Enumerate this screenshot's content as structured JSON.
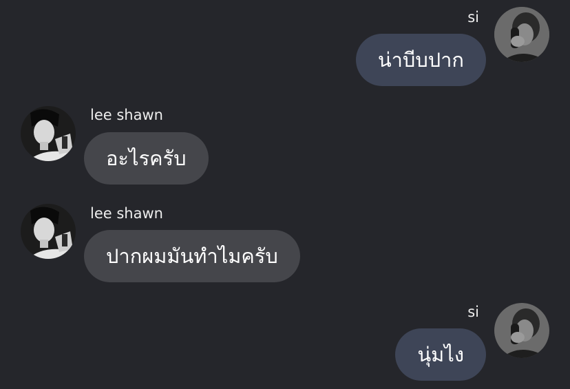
{
  "messages": [
    {
      "sender": "si",
      "text": "น่าบีบปาก",
      "direction": "outgoing"
    },
    {
      "sender": "lee shawn",
      "text": "อะไรครับ",
      "direction": "incoming"
    },
    {
      "sender": "lee shawn",
      "text": "ปากผมมันทำไมครับ",
      "direction": "incoming"
    },
    {
      "sender": "si",
      "text": "นุ่มไง",
      "direction": "outgoing"
    }
  ],
  "colors": {
    "background": "#25262b",
    "outgoing_bubble": "#3e4557",
    "incoming_bubble": "#45464b",
    "text": "#ffffff"
  }
}
